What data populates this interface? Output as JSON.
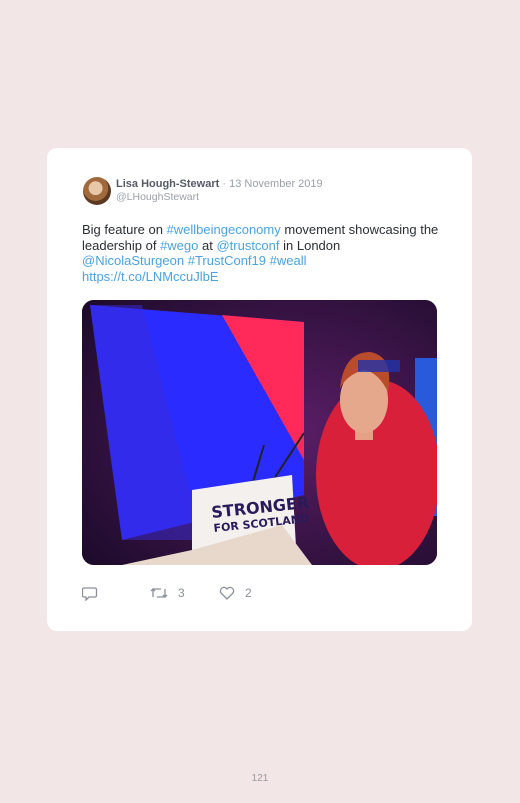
{
  "tweet": {
    "author_name": "Lisa Hough-Stewart",
    "date": "· 13 November 2019",
    "handle": "@LHoughStewart",
    "text_parts": [
      {
        "t": "Big feature on ",
        "link": false
      },
      {
        "t": "#wellbeingeconomy",
        "link": true
      },
      {
        "t": " movement showcasing the leadership of ",
        "link": false
      },
      {
        "t": "#wego",
        "link": true
      },
      {
        "t": " at ",
        "link": false
      },
      {
        "t": "@trustconf",
        "link": true
      },
      {
        "t": " in London ",
        "link": false
      },
      {
        "t": "@NicolaSturgeon",
        "link": true
      },
      {
        "t": " ",
        "link": false
      },
      {
        "t": "#TrustConf19",
        "link": true
      },
      {
        "t": " ",
        "link": false
      },
      {
        "t": "#weall",
        "link": true
      },
      {
        "t": " ",
        "link": false
      },
      {
        "t": "https://t.co/LNMccuJlbE",
        "link": true
      }
    ],
    "media": {
      "podium_line1": "STRONGER",
      "podium_line2": "FOR SCOTLAND"
    },
    "actions": {
      "reply_icon": "reply-icon",
      "retweet_icon": "retweet-icon",
      "retweet_count": "3",
      "like_icon": "heart-icon",
      "like_count": "2"
    }
  },
  "page_number": "121",
  "colors": {
    "background": "#f2e6e6",
    "card": "#ffffff",
    "link": "#4aa3df"
  }
}
